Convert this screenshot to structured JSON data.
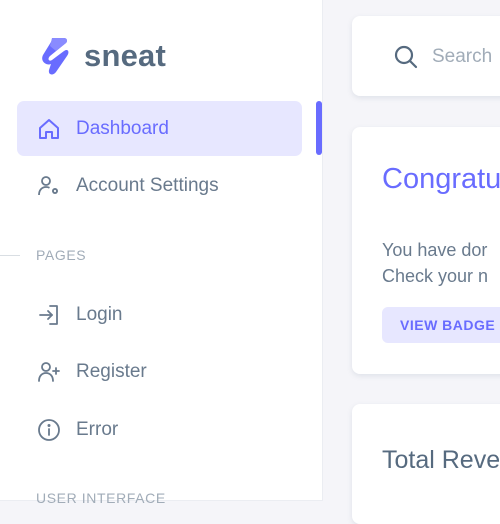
{
  "brand": {
    "name": "sneat",
    "logo_icon": "sneat-logo-icon",
    "accent": "#696cff"
  },
  "sidebar": {
    "items": [
      {
        "label": "Dashboard",
        "icon": "home-icon",
        "active": true
      },
      {
        "label": "Account Settings",
        "icon": "user-gear-icon"
      }
    ],
    "sections": [
      {
        "header": "PAGES",
        "items": [
          {
            "label": "Login",
            "icon": "login-icon"
          },
          {
            "label": "Register",
            "icon": "user-plus-icon"
          },
          {
            "label": "Error",
            "icon": "info-circle-icon"
          }
        ]
      },
      {
        "header": "USER INTERFACE"
      }
    ]
  },
  "search": {
    "placeholder": "Search",
    "icon": "search-icon"
  },
  "welcome": {
    "title": "Congratu",
    "line1": "You have dor",
    "line2": "Check your n",
    "button": "VIEW BADGE"
  },
  "revenue": {
    "title": "Total Reve"
  }
}
